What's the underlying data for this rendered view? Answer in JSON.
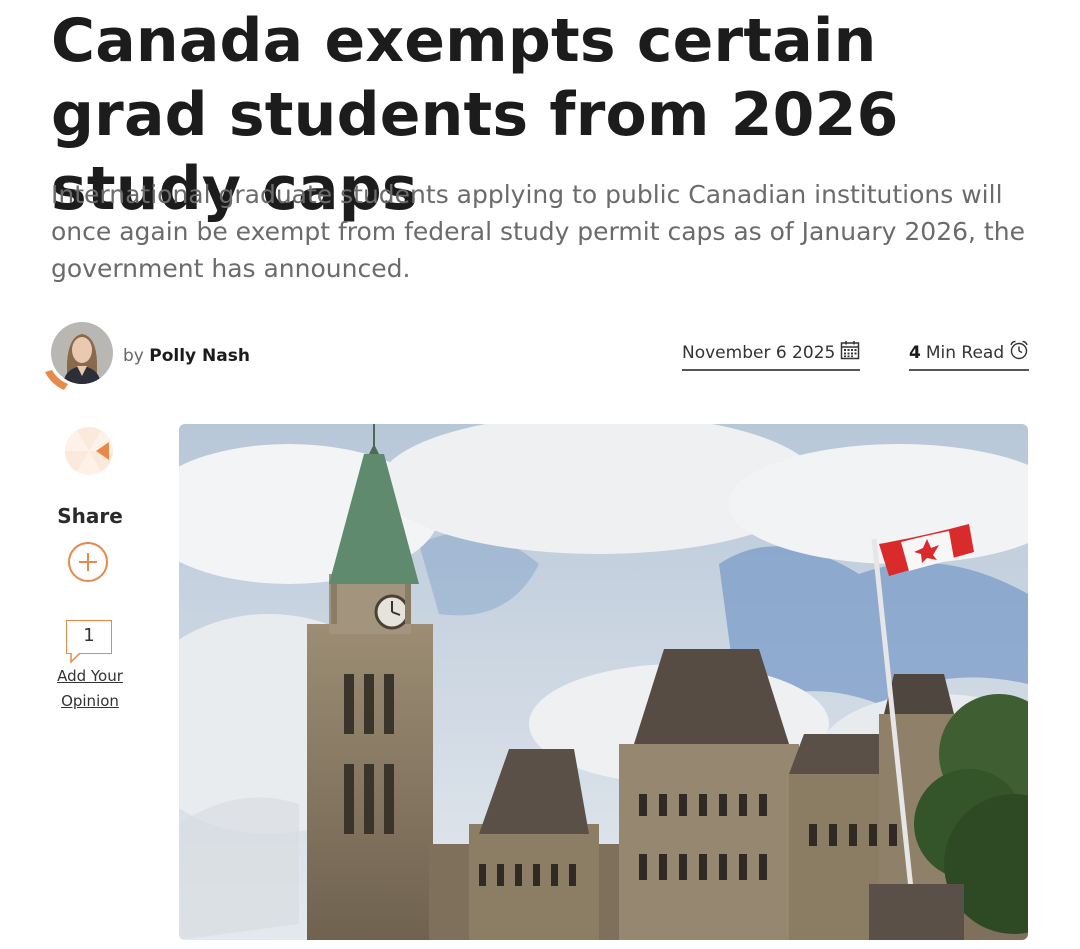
{
  "article": {
    "headline": "Canada exempts certain grad students from 2026 study caps",
    "standfirst": "International graduate students applying to public Canadian institutions will once again be exempt from federal study permit caps as of January 2026, the government has announced."
  },
  "author": {
    "prefix": "by",
    "name": "Polly Nash"
  },
  "meta": {
    "date": "November 6 2025",
    "read_minutes": "4",
    "read_label": "Min Read"
  },
  "share": {
    "label": "Share",
    "comment_count": "1",
    "opinion_line1": "Add Your",
    "opinion_line2": "Opinion"
  },
  "icons": {
    "calendar": "calendar-icon",
    "clock": "alarm-clock-icon",
    "plus": "plus-icon",
    "comment": "speech-bubble-icon"
  },
  "colors": {
    "accent": "#e8894a",
    "headline": "#1c1c1c",
    "standfirst": "#6b6b6b"
  }
}
